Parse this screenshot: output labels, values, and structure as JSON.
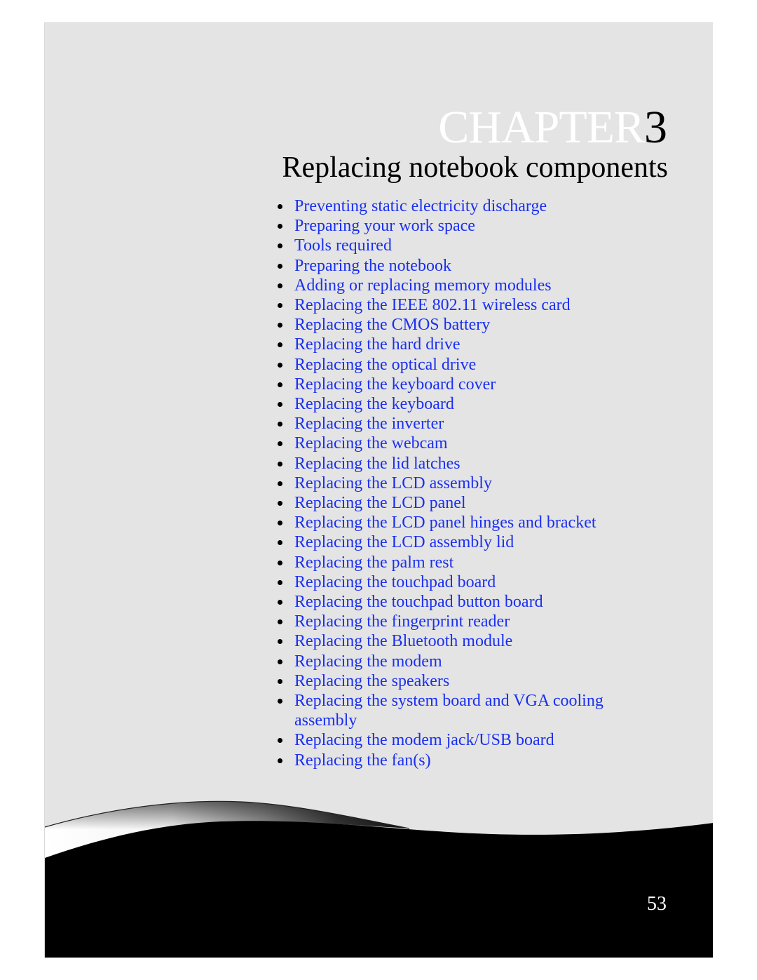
{
  "chapter": {
    "label": "CHAPTER",
    "number": "3",
    "title": "Replacing notebook components"
  },
  "toc": [
    {
      "label": "Preventing static electricity discharge"
    },
    {
      "label": "Preparing your work space"
    },
    {
      "label": "Tools required"
    },
    {
      "label": "Preparing the notebook"
    },
    {
      "label": "Adding or replacing memory modules"
    },
    {
      "label": "Replacing the IEEE 802.11 wireless card"
    },
    {
      "label": "Replacing the CMOS battery"
    },
    {
      "label": "Replacing the hard drive"
    },
    {
      "label": "Replacing the optical drive"
    },
    {
      "label": "Replacing the keyboard cover"
    },
    {
      "label": "Replacing the keyboard"
    },
    {
      "label": "Replacing the inverter"
    },
    {
      "label": "Replacing the webcam"
    },
    {
      "label": "Replacing the lid latches"
    },
    {
      "label": "Replacing the LCD assembly"
    },
    {
      "label": "Replacing the LCD panel"
    },
    {
      "label": "Replacing the LCD panel hinges and bracket"
    },
    {
      "label": "Replacing the LCD assembly lid"
    },
    {
      "label": "Replacing the palm rest"
    },
    {
      "label": "Replacing the touchpad board"
    },
    {
      "label": "Replacing the touchpad button board"
    },
    {
      "label": "Replacing the fingerprint reader"
    },
    {
      "label": "Replacing the Bluetooth module"
    },
    {
      "label": "Replacing the modem"
    },
    {
      "label": "Replacing the speakers"
    },
    {
      "label": "Replacing the system board and VGA cooling assembly"
    },
    {
      "label": "Replacing the modem jack/USB board"
    },
    {
      "label": "Replacing the fan(s)"
    }
  ],
  "footer": {
    "page_number": "53"
  },
  "colors": {
    "link": "#1a2ff0",
    "page_background": "#e4e4e4",
    "footer_band": "#000000"
  }
}
